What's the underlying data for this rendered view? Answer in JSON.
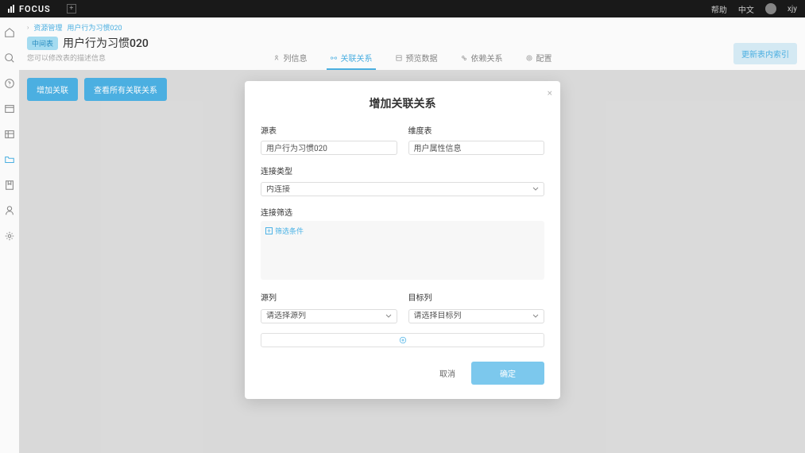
{
  "topbar": {
    "logo": "FOCUS",
    "help": "帮助",
    "lang": "中文",
    "user": "xjy"
  },
  "breadcrumb": {
    "item1": "资源管理",
    "item2": "用户行为习惯020"
  },
  "page": {
    "badge": "中间表",
    "title": "用户行为习惯020",
    "subtitle": "您可以修改表的描述信息",
    "updateBtn": "更新表内索引"
  },
  "tabs": {
    "t1": "列信息",
    "t2": "关联关系",
    "t3": "预览数据",
    "t4": "依赖关系",
    "t5": "配置"
  },
  "actions": {
    "addRel": "增加关联",
    "viewAll": "查看所有关联关系"
  },
  "modal": {
    "title": "增加关联关系",
    "sourceTable": "源表",
    "sourceTableVal": "用户行为习惯020",
    "dimTable": "维度表",
    "dimTableVal": "用户属性信息",
    "joinType": "连接类型",
    "joinTypeVal": "内连接",
    "joinFilter": "连接筛选",
    "filterAdd": "筛选条件",
    "sourceCol": "源列",
    "sourceColPh": "请选择源列",
    "targetCol": "目标列",
    "targetColPh": "请选择目标列",
    "cancel": "取消",
    "confirm": "确定"
  }
}
